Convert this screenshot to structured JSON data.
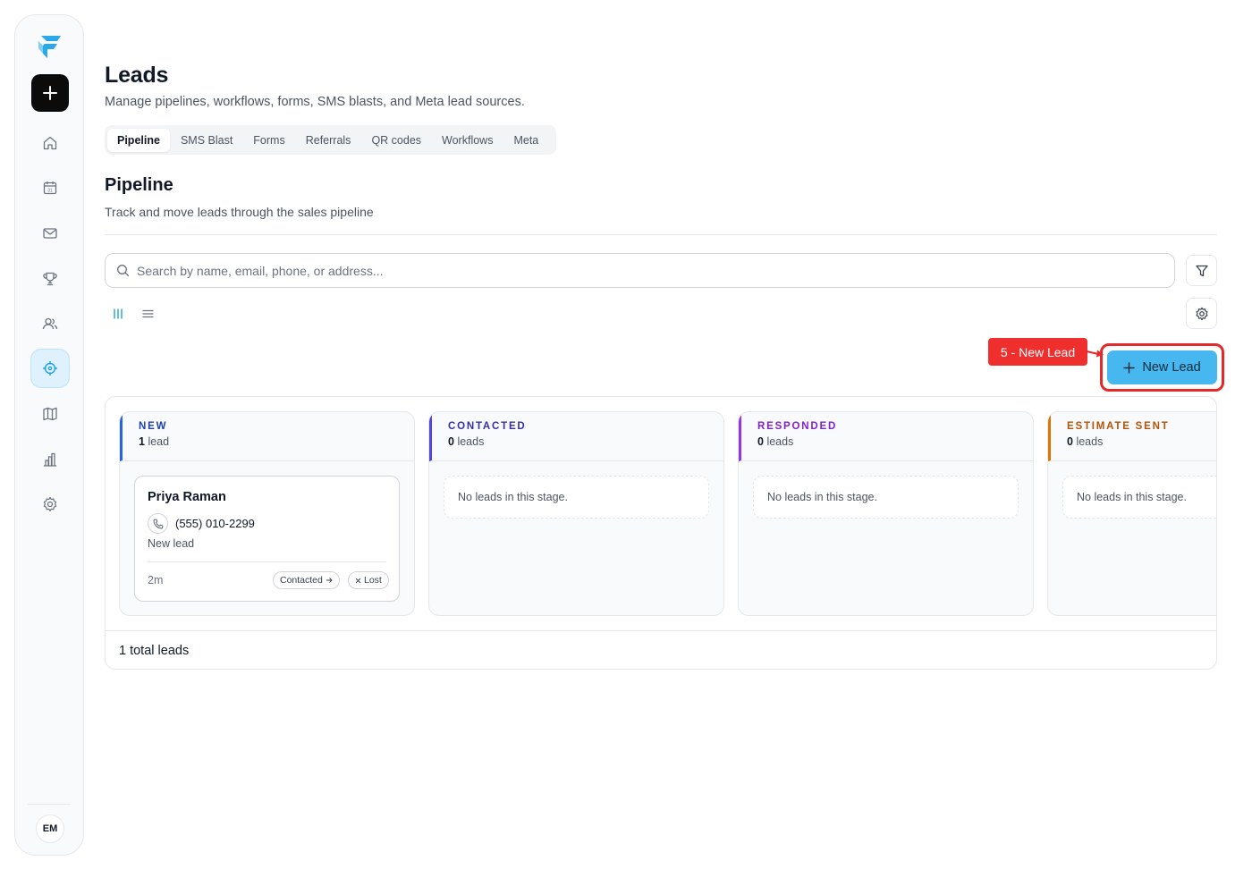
{
  "sidebar": {
    "items": [
      {
        "icon": "home-icon"
      },
      {
        "icon": "calendar-icon",
        "text": "31"
      },
      {
        "icon": "mail-icon"
      },
      {
        "icon": "trophy-icon"
      },
      {
        "icon": "users-icon"
      },
      {
        "icon": "target-icon",
        "active": true
      },
      {
        "icon": "map-icon"
      },
      {
        "icon": "chart-icon"
      },
      {
        "icon": "gear-icon"
      }
    ],
    "avatar": "EM"
  },
  "page": {
    "title": "Leads",
    "subtitle": "Manage pipelines, workflows, forms, SMS blasts, and Meta lead sources."
  },
  "tabs": [
    "Pipeline",
    "SMS Blast",
    "Forms",
    "Referrals",
    "QR codes",
    "Workflows",
    "Meta"
  ],
  "active_tab": "Pipeline",
  "pipeline": {
    "title": "Pipeline",
    "subtitle": "Track and move leads through the sales pipeline",
    "search_placeholder": "Search by name, email, phone, or address...",
    "new_lead_label": "New Lead",
    "annotation": "5 - New Lead"
  },
  "columns": [
    {
      "title": "NEW",
      "count": "1",
      "unit": "lead",
      "color": "#2563eb",
      "title_color": "#1e40af"
    },
    {
      "title": "CONTACTED",
      "count": "0",
      "unit": "leads",
      "color": "#4f46e5",
      "title_color": "#3730a3",
      "empty": "No leads in this stage."
    },
    {
      "title": "RESPONDED",
      "count": "0",
      "unit": "leads",
      "color": "#9333ea",
      "title_color": "#7e22ce",
      "empty": "No leads in this stage."
    },
    {
      "title": "ESTIMATE SENT",
      "count": "0",
      "unit": "leads",
      "color": "#d97706",
      "title_color": "#b45309",
      "empty": "No leads in this stage."
    }
  ],
  "lead": {
    "name": "Priya Raman",
    "phone": "(555) 010-2299",
    "status": "New lead",
    "time": "2m",
    "action_contacted": "Contacted",
    "action_lost": "Lost"
  },
  "footer": "1 total leads"
}
